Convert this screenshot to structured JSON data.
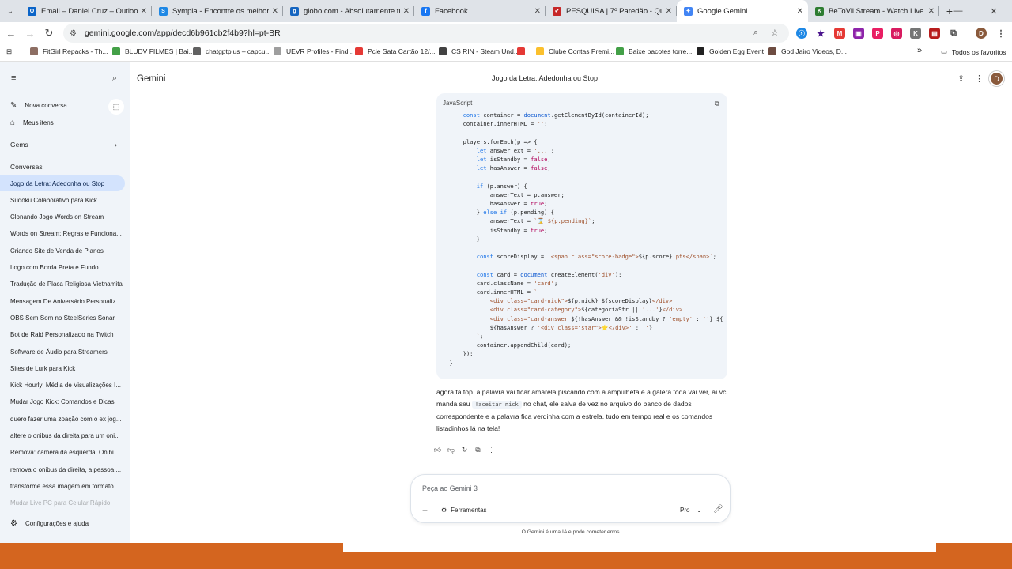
{
  "browser": {
    "tabs": [
      {
        "title": "Email – Daniel Cruz – Outlook",
        "icon": "outlook-icon",
        "color": "#0a64c8",
        "glyph": "O"
      },
      {
        "title": "Sympla - Encontre os melhores",
        "icon": "sympla-icon",
        "color": "#1e88e5",
        "glyph": "S"
      },
      {
        "title": "globo.com - Absolutamente tu",
        "icon": "globo-icon",
        "color": "#1565c0",
        "glyph": "g"
      },
      {
        "title": "Facebook",
        "icon": "facebook-icon",
        "color": "#1877f2",
        "glyph": "f"
      },
      {
        "title": "PESQUISA | 7º Paredão - Quem",
        "icon": "check-icon",
        "color": "#c62828",
        "glyph": "✔"
      },
      {
        "title": "Google Gemini",
        "icon": "gemini-icon",
        "color": "#4285f4",
        "glyph": "✦",
        "active": true
      },
      {
        "title": "BeToVii Stream - Watch Live on",
        "icon": "kick-icon",
        "color": "#2e7d32",
        "glyph": "K"
      }
    ],
    "address": {
      "url": "gemini.google.com/app/decd6b961cb2f4b9?hl=pt-BR"
    },
    "bookmarks": [
      {
        "label": "FitGirl Repacks - Th...",
        "color": "#8d6e63"
      },
      {
        "label": "BLUDV FILMES | Bai...",
        "color": "#43a047"
      },
      {
        "label": "chatgptplus – capcu...",
        "color": "#616161"
      },
      {
        "label": "UEVR Profiles - Find...",
        "color": "#9e9e9e"
      },
      {
        "label": "Pcie Sata Cartão 12/...",
        "color": "#e53935"
      },
      {
        "label": "CS RIN - Steam Und...",
        "color": "#424242"
      },
      {
        "label": "",
        "color": "#e53935"
      },
      {
        "label": "Clube Contas Premi...",
        "color": "#fbc02d"
      },
      {
        "label": "Baixe pacotes torre...",
        "color": "#43a047"
      },
      {
        "label": "Golden Egg Event",
        "color": "#212121"
      },
      {
        "label": "God Jairo Videos, D...",
        "color": "#6d4c41"
      }
    ],
    "bookmarks_more": "»",
    "favorites_folder": "Todos os favoritos"
  },
  "app": {
    "name": "Gemini",
    "conversation_title": "Jogo da Letra: Adedonha ou Stop",
    "avatar_letter": "D"
  },
  "sidebar": {
    "new_chat": "Nova conversa",
    "my_items": "Meus itens",
    "gems": "Gems",
    "conversations_header": "Conversas",
    "conversations": [
      "Jogo da Letra: Adedonha ou Stop",
      "Sudoku Colaborativo para Kick",
      "Clonando Jogo Words on Stream",
      "Words on Stream: Regras e Funciona...",
      "Criando Site de Venda de Planos",
      "Logo com Borda Preta e Fundo",
      "Tradução de Placa Religiosa Vietnamita",
      "Mensagem De Aniversário Personaliz...",
      "OBS Sem Som no SteelSeries Sonar",
      "Bot de Raid Personalizado na Twitch",
      "Software de Áudio para Streamers",
      "Sites de Lurk para Kick",
      "Kick Hourly: Média de Visualizações I...",
      "Mudar Jogo Kick: Comandos e Dicas",
      "quero fazer uma zoação com o ex jog...",
      "altere o onibus da direita para um oni...",
      "Remova: camera da esquerda. Onibu...",
      "remova o onibus da direita, a pessoa ...",
      "transforme essa imagem em formato ...",
      "Mudar Live PC para Celular Rápido"
    ],
    "settings": "Configurações e ajuda"
  },
  "code_block": {
    "language": "JavaScript"
  },
  "reply": {
    "part1": "agora tá top. a palavra vai ficar amarela piscando com a ampulheta e a galera toda vai ver, aí vc manda seu ",
    "command": "!aceitar nick",
    "part2": " no chat, ele salva de vez no arquivo do banco de dados correspondente e a palavra fica verdinha com a estrela. tudo em tempo real e os comandos listadinhos lá na tela!"
  },
  "prompt": {
    "placeholder": "Peça ao Gemini 3",
    "tools_label": "Ferramentas",
    "model_label": "Pro"
  },
  "disclaimer": "O Gemini é uma IA e pode cometer erros."
}
